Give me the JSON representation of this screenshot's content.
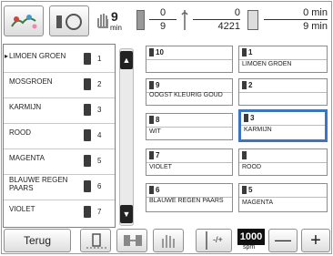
{
  "toolbar": {
    "pause_count": "9",
    "pause_unit": "min",
    "color_current": "0",
    "color_total": "9",
    "stitch_current": "0",
    "stitch_total": "4221",
    "time_current": "0 min",
    "time_total": "9 min"
  },
  "color_list": {
    "items": [
      {
        "name": "LIMOEN GROEN",
        "num": "1",
        "current": true
      },
      {
        "name": "MOSGROEN",
        "num": "2"
      },
      {
        "name": "KARMIJN",
        "num": "3"
      },
      {
        "name": "ROOD",
        "num": "4"
      },
      {
        "name": "MAGENTA",
        "num": "5"
      },
      {
        "name": "BLAUWE REGEN PAARS",
        "num": "6"
      },
      {
        "name": "VIOLET",
        "num": "7"
      }
    ],
    "current_marker": "▸"
  },
  "needles": {
    "col1": [
      {
        "num": "10",
        "name": ""
      },
      {
        "num": "9",
        "name": "OOGST KLEURIG GOUD"
      },
      {
        "num": "8",
        "name": "WIT"
      },
      {
        "num": "7",
        "name": "VIOLET"
      },
      {
        "num": "6",
        "name": "BLAUWE REGEN PAARS"
      }
    ],
    "col2": [
      {
        "num": "1",
        "name": "LIMOEN GROEN"
      },
      {
        "num": "2",
        "name": ""
      },
      {
        "num": "3",
        "name": "KARMIJN",
        "selected": true
      },
      {
        "num": "",
        "name": "ROOD"
      },
      {
        "num": "5",
        "name": "MAGENTA"
      }
    ]
  },
  "bottom": {
    "back_label": "Terug",
    "speed_value": "1000",
    "speed_unit": "spm",
    "minus_label": "—",
    "plus_label": "+",
    "needle_adjust_label": "-/+"
  },
  "colors": {
    "accent": "#3a74c4",
    "dark": "#222222"
  }
}
